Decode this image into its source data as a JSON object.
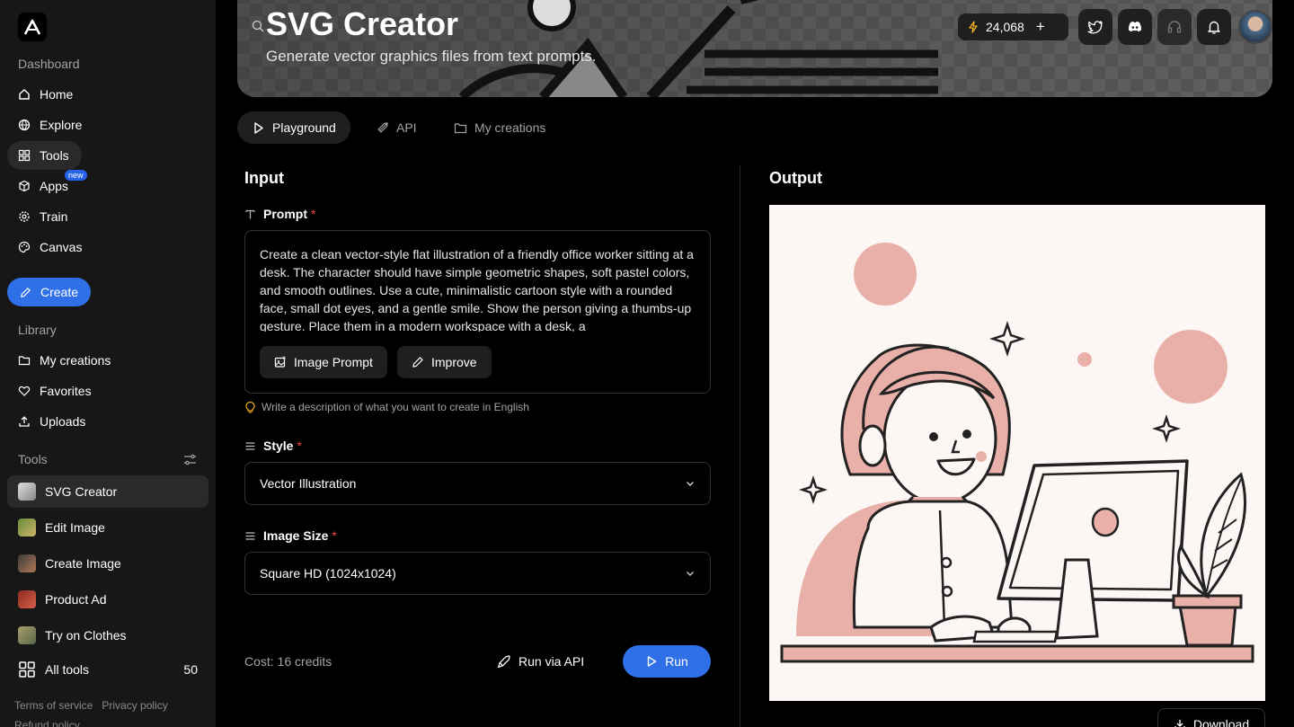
{
  "sidebar": {
    "dashboard_label": "Dashboard",
    "nav": [
      {
        "label": "Home",
        "icon": "home-icon"
      },
      {
        "label": "Explore",
        "icon": "globe-icon"
      },
      {
        "label": "Tools",
        "icon": "grid-icon"
      },
      {
        "label": "Apps",
        "icon": "cube-icon",
        "badge": "new"
      },
      {
        "label": "Train",
        "icon": "gear-icon"
      },
      {
        "label": "Canvas",
        "icon": "palette-icon"
      }
    ],
    "create_label": "Create",
    "library_label": "Library",
    "library": [
      {
        "label": "My creations",
        "icon": "folder-icon"
      },
      {
        "label": "Favorites",
        "icon": "heart-icon"
      },
      {
        "label": "Uploads",
        "icon": "upload-icon"
      }
    ],
    "tools_label": "Tools",
    "tools": [
      {
        "label": "SVG Creator"
      },
      {
        "label": "Edit Image"
      },
      {
        "label": "Create Image"
      },
      {
        "label": "Product Ad"
      },
      {
        "label": "Try on Clothes"
      }
    ],
    "all_tools_label": "All tools",
    "all_tools_count": "50",
    "footer": {
      "terms": "Terms of service",
      "privacy": "Privacy policy",
      "refund": "Refund policy"
    }
  },
  "header": {
    "title": "SVG Creator",
    "subtitle": "Generate vector graphics files from text prompts.",
    "credits": "24,068"
  },
  "tabs": [
    {
      "label": "Playground",
      "active": true
    },
    {
      "label": "API"
    },
    {
      "label": "My creations"
    }
  ],
  "input": {
    "title": "Input",
    "prompt_label": "Prompt",
    "prompt_value": "Create a clean vector-style flat illustration of a friendly office worker sitting at a desk. The character should have simple geometric shapes, soft pastel colors, and smooth outlines. Use a cute, minimalistic cartoon style with a rounded face, small dot eyes, and a gentle smile. Show the person giving a thumbs-up gesture. Place them in a modern workspace with a desk, a",
    "image_prompt_label": "Image Prompt",
    "improve_label": "Improve",
    "hint": "Write a description of what you want to create in English",
    "style_label": "Style",
    "style_value": "Vector Illustration",
    "size_label": "Image Size",
    "size_value": "Square HD (1024x1024)",
    "cost": "Cost: 16 credits",
    "run_api_label": "Run via API",
    "run_label": "Run"
  },
  "output": {
    "title": "Output",
    "download_label": "Download"
  },
  "colors": {
    "accent": "#2f6fe8",
    "required": "#ef4444",
    "illustration_pink": "#e8b0a8"
  }
}
